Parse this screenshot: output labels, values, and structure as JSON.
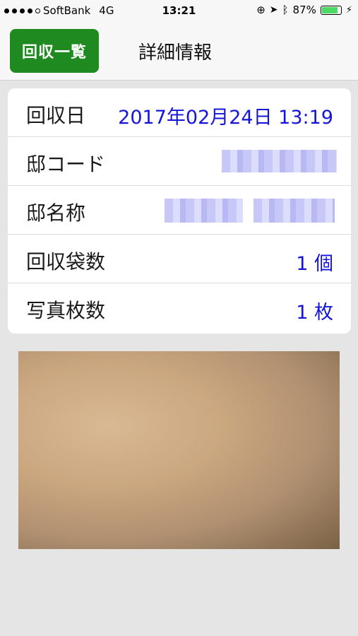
{
  "status_bar": {
    "carrier": "SoftBank",
    "network": "4G",
    "time": "13:21",
    "battery_percent": "87%",
    "battery_level": 0.87
  },
  "nav": {
    "back_label": "回収一覧",
    "title": "詳細情報",
    "back_color": "#1f8a1f"
  },
  "detail": {
    "rows": [
      {
        "label": "回収日",
        "value": "2017年02月24日 13:19"
      },
      {
        "label": "邸コード",
        "value": ""
      },
      {
        "label": "邸名称",
        "value": ""
      },
      {
        "label": "回収袋数",
        "value": "1 個"
      },
      {
        "label": "写真枚数",
        "value": "1 枚"
      }
    ],
    "value_color": "#1515d8"
  },
  "photo": {
    "icon": "photo-thumbnail"
  }
}
